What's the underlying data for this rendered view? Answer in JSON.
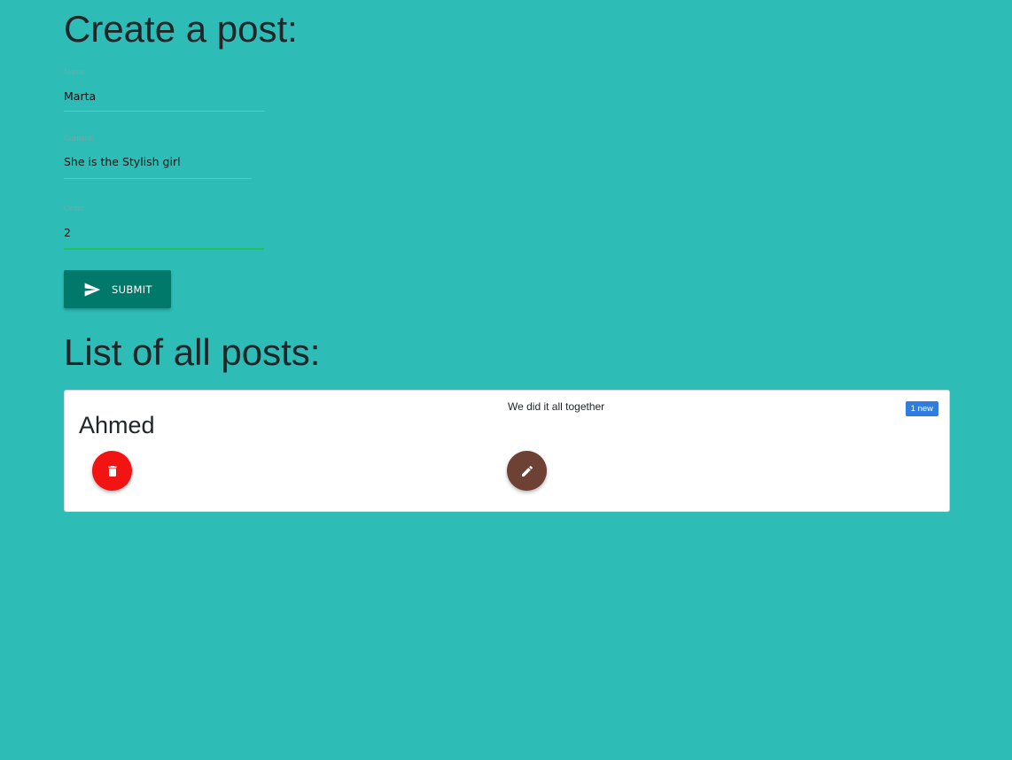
{
  "form": {
    "title": "Create a post:",
    "fields": [
      {
        "label": "Name:",
        "value": "Marta"
      },
      {
        "label": "Content:",
        "value": "She is the Stylish girl"
      },
      {
        "label": "Order:",
        "value": "2"
      }
    ],
    "submit_label": "SUBMIT",
    "submit_icon": "send-icon"
  },
  "list": {
    "title": "List of all posts:",
    "posts": [
      {
        "author": "Ahmed",
        "content": "We did it all together",
        "badge": "1 new",
        "delete_icon": "trash-icon",
        "edit_icon": "pencil-icon"
      }
    ]
  },
  "colors": {
    "background": "#2ebdb6",
    "submit_button": "#00796b",
    "delete_button": "#f21313",
    "edit_button": "#6d4134",
    "badge": "#2f7de1",
    "active_underline": "#26c15e"
  }
}
